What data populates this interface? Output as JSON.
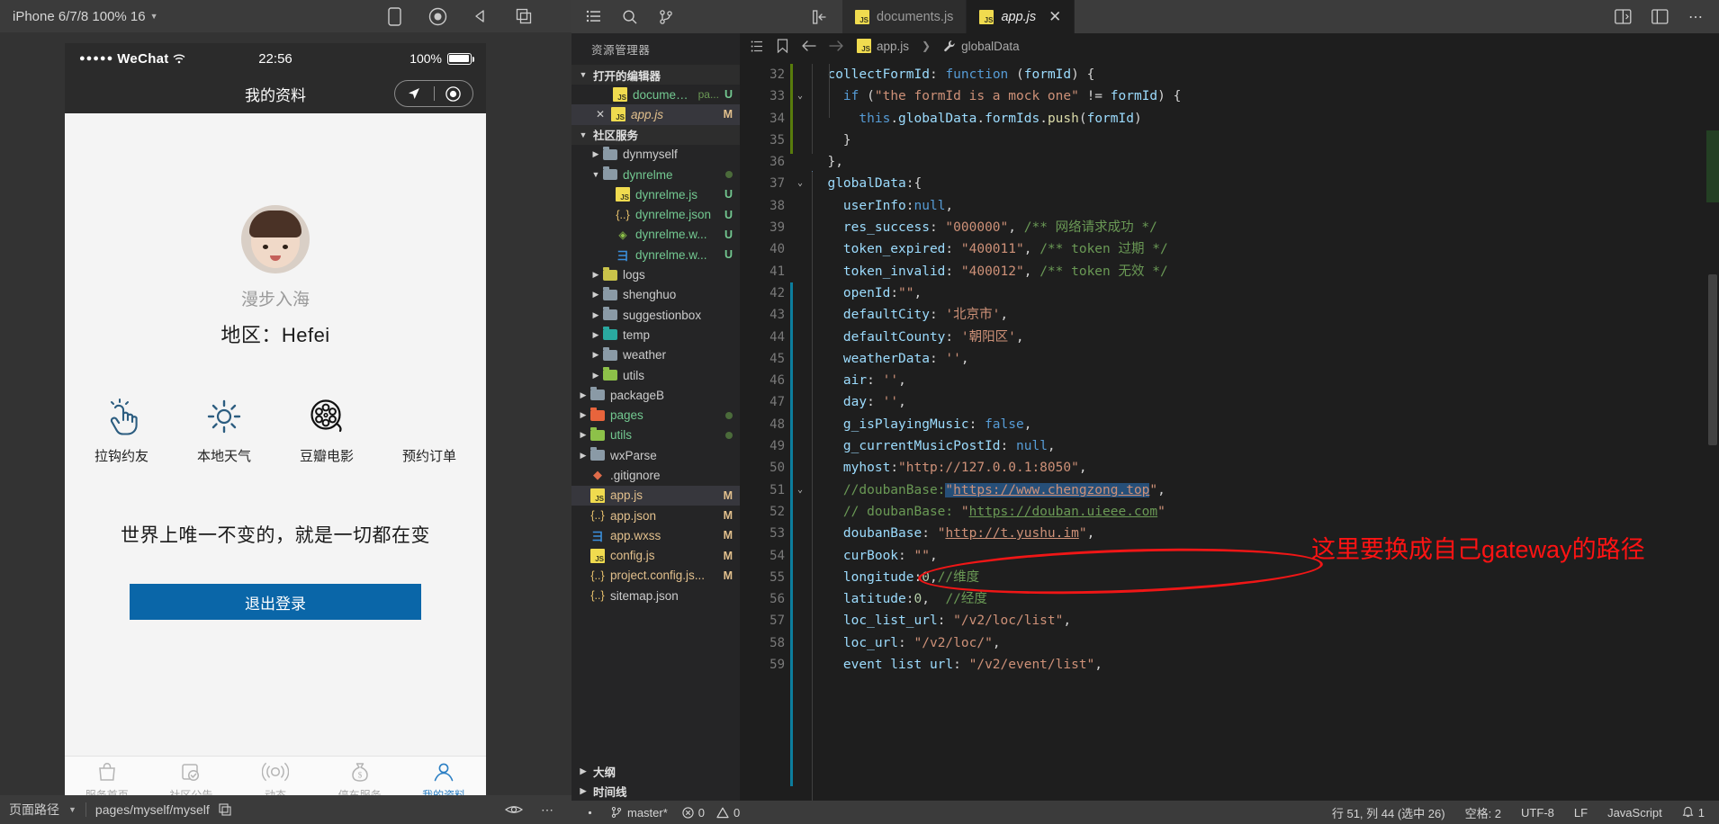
{
  "simulator": {
    "device_label": "iPhone 6/7/8 100% 16",
    "toolbar_icons": [
      "phone-icon",
      "record-icon",
      "back-icon",
      "copy-icon"
    ],
    "status_bar": {
      "carrier": "WeChat",
      "signal_dots": "●●●●●",
      "time": "22:56",
      "battery": "100%"
    },
    "nav_title": "我的资料",
    "profile": {
      "nickname": "漫步入海",
      "region_label": "地区：",
      "region_value": "Hefei"
    },
    "grid": [
      {
        "label": "拉钩约友",
        "icon": "tap-hand-icon"
      },
      {
        "label": "本地天气",
        "icon": "sun-icon"
      },
      {
        "label": "豆瓣电影",
        "icon": "film-reel-icon"
      },
      {
        "label": "预约订单",
        "icon": "order-icon"
      }
    ],
    "slogan": "世界上唯一不变的，就是一切都在变",
    "logout_label": "退出登录",
    "tabbar": [
      {
        "label": "服务首页",
        "icon": "bag-icon",
        "active": false
      },
      {
        "label": "社区公告",
        "icon": "doc-check-icon",
        "active": false
      },
      {
        "label": "动态",
        "icon": "broadcast-icon",
        "active": false
      },
      {
        "label": "停车服务",
        "icon": "money-bag-icon",
        "active": false
      },
      {
        "label": "我的资料",
        "icon": "person-icon",
        "active": true
      }
    ],
    "footer": {
      "path_label": "页面路径",
      "path_value": "pages/myself/myself",
      "icons": [
        "copy-icon",
        "eye-icon",
        "more-icon"
      ]
    }
  },
  "vscode": {
    "activity_icons": [
      "explorer-icon",
      "search-icon",
      "source-control-icon"
    ],
    "sidebar_toggle_icon": "toggle-sidebar-icon",
    "tabs": [
      {
        "label": "documents.js",
        "icon": "js-icon",
        "active": false,
        "dirty": false
      },
      {
        "label": "app.js",
        "icon": "js-icon",
        "active": true,
        "dirty": false
      }
    ],
    "titlebar_right_icons": [
      "split-editor-icon",
      "layout-icon",
      "more-actions-icon"
    ],
    "breadcrumb": {
      "file": "app.js",
      "symbol": "globalData",
      "icons": [
        "outline-icon",
        "bookmark-icon",
        "back-arrow-icon",
        "forward-arrow-icon"
      ]
    },
    "explorer": {
      "title": "资源管理器",
      "sections": [
        {
          "label": "打开的编辑器",
          "expanded": true
        },
        {
          "label": "社区服务",
          "expanded": true
        },
        {
          "label": "大纲",
          "expanded": false
        },
        {
          "label": "时间线",
          "expanded": false
        }
      ],
      "open_editors": [
        {
          "name": "documents.js",
          "sub": "pa...",
          "badge": "U",
          "badge_color": "#73c991",
          "icon": "js-icon",
          "indent": 3,
          "selected": false,
          "closable": false
        },
        {
          "name": "app.js",
          "sub": "",
          "badge": "M",
          "badge_color": "#e2c08d",
          "icon": "js-icon",
          "indent": 2,
          "selected": true,
          "closable": true,
          "italic": true
        }
      ],
      "tree": [
        {
          "name": "dynmyself",
          "type": "folder",
          "indent": 3,
          "expanded": false,
          "color": "#8a9aa6"
        },
        {
          "name": "dynrelme",
          "type": "folder-open",
          "indent": 3,
          "expanded": true,
          "color": "#8a9aa6",
          "name_color": "#73c991",
          "dot": true
        },
        {
          "name": "dynrelme.js",
          "type": "js",
          "indent": 4,
          "badge": "U",
          "name_color": "#73c991"
        },
        {
          "name": "dynrelme.json",
          "type": "json",
          "indent": 4,
          "badge": "U",
          "name_color": "#73c991"
        },
        {
          "name": "dynrelme.w...",
          "type": "wxml",
          "indent": 4,
          "badge": "U",
          "name_color": "#73c991"
        },
        {
          "name": "dynrelme.w...",
          "type": "wxss",
          "indent": 4,
          "badge": "U",
          "name_color": "#73c991"
        },
        {
          "name": "logs",
          "type": "folder",
          "indent": 3,
          "color": "#c9c34a"
        },
        {
          "name": "shenghuo",
          "type": "folder",
          "indent": 3,
          "color": "#8a9aa6"
        },
        {
          "name": "suggestionbox",
          "type": "folder",
          "indent": 3,
          "color": "#8a9aa6"
        },
        {
          "name": "temp",
          "type": "folder",
          "indent": 3,
          "color": "#2aa9a0"
        },
        {
          "name": "weather",
          "type": "folder",
          "indent": 3,
          "color": "#8a9aa6"
        },
        {
          "name": "utils",
          "type": "folder",
          "indent": 3,
          "color": "#8dc149"
        },
        {
          "name": "packageB",
          "type": "folder",
          "indent": 2,
          "color": "#8a9aa6"
        },
        {
          "name": "pages",
          "type": "folder",
          "indent": 2,
          "color": "#e8643c",
          "name_color": "#73c991",
          "dot": true
        },
        {
          "name": "utils",
          "type": "folder",
          "indent": 2,
          "color": "#8dc149",
          "name_color": "#73c991",
          "dot": true
        },
        {
          "name": "wxParse",
          "type": "folder",
          "indent": 2,
          "color": "#8a9aa6"
        },
        {
          "name": ".gitignore",
          "type": "git",
          "indent": 2
        },
        {
          "name": "app.js",
          "type": "js",
          "indent": 2,
          "badge": "M",
          "badge_color": "#e2c08d",
          "name_color": "#e2c08d",
          "selected": true
        },
        {
          "name": "app.json",
          "type": "json",
          "indent": 2,
          "badge": "M",
          "badge_color": "#e2c08d",
          "name_color": "#e2c08d"
        },
        {
          "name": "app.wxss",
          "type": "wxss",
          "indent": 2,
          "badge": "M",
          "badge_color": "#e2c08d",
          "name_color": "#e2c08d"
        },
        {
          "name": "config.js",
          "type": "js",
          "indent": 2,
          "badge": "M",
          "badge_color": "#e2c08d",
          "name_color": "#e2c08d"
        },
        {
          "name": "project.config.js...",
          "type": "json",
          "indent": 2,
          "badge": "M",
          "badge_color": "#e2c08d",
          "name_color": "#e2c08d"
        },
        {
          "name": "sitemap.json",
          "type": "json",
          "indent": 2,
          "name_color": "#cccccc"
        }
      ]
    },
    "code": {
      "first_line_number": 32,
      "lines": [
        {
          "n": 32,
          "partial": true,
          "html": "  <span class='prop'>collectFormId</span><span class='punct'>: </span><span class='kw'>function</span> <span class='punct'>(</span><span class='prop'>formId</span><span class='punct'>) {</span>"
        },
        {
          "n": 33,
          "fold": true,
          "html": "    <span class='kw'>if</span> <span class='punct'>(</span><span class='str'>\"the formId is a mock one\"</span> <span class='op'>!=</span> <span class='prop'>formId</span><span class='punct'>) {</span>"
        },
        {
          "n": 34,
          "html": "      <span class='lit'>this</span><span class='punct'>.</span><span class='prop'>globalData</span><span class='punct'>.</span><span class='prop'>formIds</span><span class='punct'>.</span><span class='fn'>push</span><span class='punct'>(</span><span class='prop'>formId</span><span class='punct'>)</span>"
        },
        {
          "n": 35,
          "html": "    <span class='punct'>}</span>"
        },
        {
          "n": 36,
          "html": "  <span class='punct'>},</span>"
        },
        {
          "n": 37,
          "fold": true,
          "html": "  <span class='prop'>globalData</span><span class='punct'>:{</span>"
        },
        {
          "n": 38,
          "html": "    <span class='prop'>userInfo</span><span class='punct'>:</span><span class='lit'>null</span><span class='punct'>,</span>"
        },
        {
          "n": 39,
          "html": "    <span class='prop'>res_success</span><span class='punct'>: </span><span class='str'>\"000000\"</span><span class='punct'>, </span><span class='cmt'>/** 网络请求成功 */</span>"
        },
        {
          "n": 40,
          "html": "    <span class='prop'>token_expired</span><span class='punct'>: </span><span class='str'>\"400011\"</span><span class='punct'>, </span><span class='cmt'>/** token 过期 */</span>"
        },
        {
          "n": 41,
          "html": "    <span class='prop'>token_invalid</span><span class='punct'>: </span><span class='str'>\"400012\"</span><span class='punct'>, </span><span class='cmt'>/** token 无效 */</span>"
        },
        {
          "n": 42,
          "html": "    <span class='prop'>openId</span><span class='punct'>:</span><span class='str'>\"\"</span><span class='punct'>,</span>"
        },
        {
          "n": 43,
          "html": "    <span class='prop'>defaultCity</span><span class='punct'>: </span><span class='str'>'北京市'</span><span class='punct'>,</span>"
        },
        {
          "n": 44,
          "html": "    <span class='prop'>defaultCounty</span><span class='punct'>: </span><span class='str'>'朝阳区'</span><span class='punct'>,</span>"
        },
        {
          "n": 45,
          "html": "    <span class='prop'>weatherData</span><span class='punct'>: </span><span class='str'>''</span><span class='punct'>,</span>"
        },
        {
          "n": 46,
          "html": "    <span class='prop'>air</span><span class='punct'>: </span><span class='str'>''</span><span class='punct'>,</span>"
        },
        {
          "n": 47,
          "html": "    <span class='prop'>day</span><span class='punct'>: </span><span class='str'>''</span><span class='punct'>,</span>"
        },
        {
          "n": 48,
          "html": "    <span class='prop'>g_isPlayingMusic</span><span class='punct'>: </span><span class='lit'>false</span><span class='punct'>,</span>"
        },
        {
          "n": 49,
          "html": "    <span class='prop'>g_currentMusicPostId</span><span class='punct'>: </span><span class='lit'>null</span><span class='punct'>,</span>"
        },
        {
          "n": 50,
          "html": "    <span class='prop'>myhost</span><span class='punct'>:</span><span class='str'>\"http://127.0.0.1:8050\"</span><span class='punct'>,</span>"
        },
        {
          "n": 51,
          "fold": true,
          "html": "    <span class='cmt'>//doubanBase:</span><span class='sel'><span class='str'>\"</span><span class='link'>https://www.chengzong.top</span></span><span class='str'>\"</span><span class='punct'>,</span>"
        },
        {
          "n": 52,
          "html": "    <span class='cmt'>// doubanBase: </span><span class='str'>\"</span><span class='cmt' style='text-decoration:underline'>https://douban.uieee.com</span><span class='str'>\"</span>"
        },
        {
          "n": 53,
          "html": "    <span class='prop'>doubanBase</span><span class='punct'>: </span><span class='str'>\"</span><span class='link'>http://t.yushu.im</span><span class='str'>\"</span><span class='punct'>,</span>"
        },
        {
          "n": 54,
          "html": "    <span class='prop'>curBook</span><span class='punct'>: </span><span class='str'>\"\"</span><span class='punct'>,</span>"
        },
        {
          "n": 55,
          "html": "    <span class='prop'>longitude</span><span class='punct'>:</span><span class='num'>0</span><span class='punct'>,</span><span class='cmt'>//维度</span>"
        },
        {
          "n": 56,
          "html": "    <span class='prop'>latitude</span><span class='punct'>:</span><span class='num'>0</span><span class='punct'>,  </span><span class='cmt'>//经度</span>"
        },
        {
          "n": 57,
          "html": "    <span class='prop'>loc_list_url</span><span class='punct'>: </span><span class='str'>\"/v2/loc/list\"</span><span class='punct'>,</span>"
        },
        {
          "n": 58,
          "html": "    <span class='prop'>loc_url</span><span class='punct'>: </span><span class='str'>\"/v2/loc/\"</span><span class='punct'>,</span>"
        },
        {
          "n": 59,
          "html": "    <span class='prop'>event list url</span><span class='punct'>: </span><span class='str'>\"/v2/event/list\"</span><span class='punct'>,</span>"
        }
      ]
    },
    "annotation": {
      "text": "这里要换成自己gateway的路径",
      "color": "#ff1313"
    },
    "statusbar": {
      "branch": "master*",
      "errors": "0",
      "warnings": "0",
      "cursor": "行 51, 列 44 (选中 26)",
      "spaces": "空格: 2",
      "encoding": "UTF-8",
      "eol": "LF",
      "language": "JavaScript",
      "bell_count": "1"
    }
  }
}
